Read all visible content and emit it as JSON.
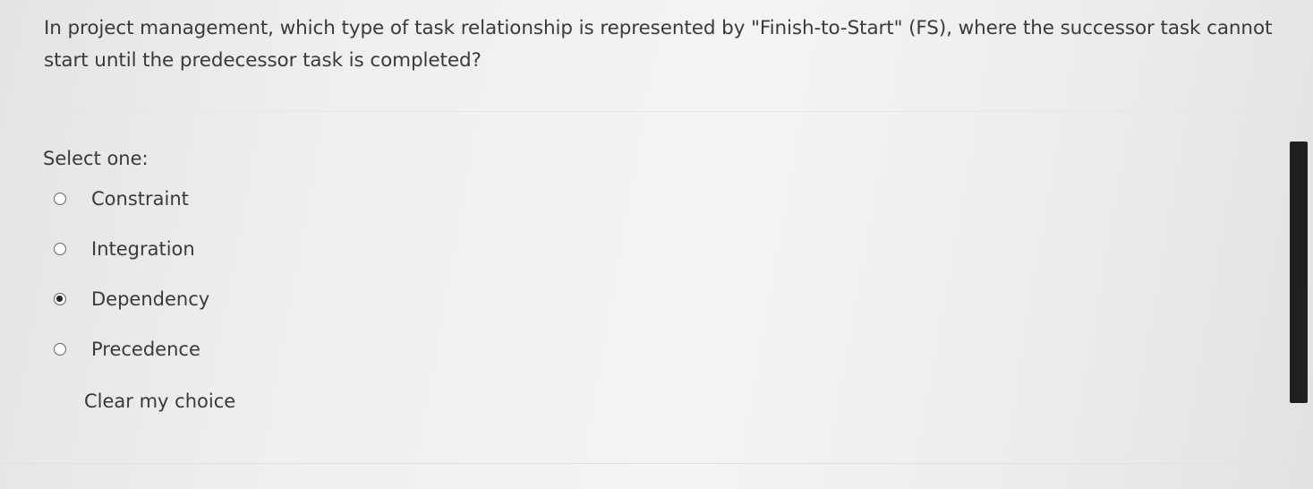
{
  "question": {
    "text": "In project management, which type of task relationship is represented by \"Finish-to-Start\" (FS), where the successor task cannot start until the predecessor task is completed?"
  },
  "answer": {
    "prompt": "Select one:",
    "options": [
      {
        "label": "Constraint",
        "checked": false
      },
      {
        "label": "Integration",
        "checked": false
      },
      {
        "label": "Dependency",
        "checked": true
      },
      {
        "label": "Precedence",
        "checked": false
      }
    ],
    "clear_label": "Clear my choice"
  }
}
